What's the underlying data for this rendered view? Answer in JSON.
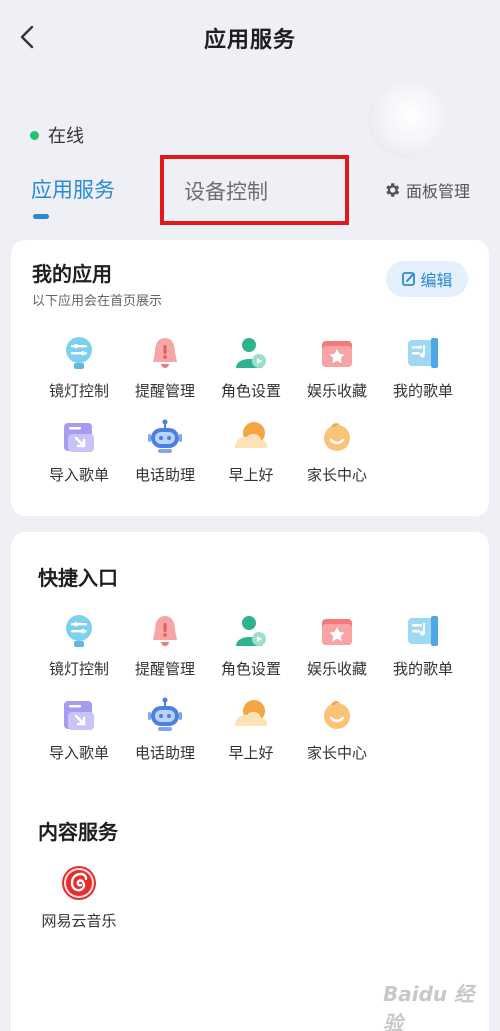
{
  "header": {
    "title": "应用服务"
  },
  "status": {
    "label": "在线"
  },
  "tabs": {
    "app_services": "应用服务",
    "device_control": "设备控制",
    "panel_management": "面板管理"
  },
  "my_apps": {
    "title": "我的应用",
    "subtitle": "以下应用会在首页展示",
    "edit_label": "编辑",
    "items": [
      {
        "label": "镜灯控制",
        "icon": "lamp-control-icon"
      },
      {
        "label": "提醒管理",
        "icon": "bell-icon"
      },
      {
        "label": "角色设置",
        "icon": "person-icon"
      },
      {
        "label": "娱乐收藏",
        "icon": "star-folder-icon"
      },
      {
        "label": "我的歌单",
        "icon": "playlist-icon"
      },
      {
        "label": "导入歌单",
        "icon": "import-playlist-icon"
      },
      {
        "label": "电话助理",
        "icon": "robot-icon"
      },
      {
        "label": "早上好",
        "icon": "sunrise-icon"
      },
      {
        "label": "家长中心",
        "icon": "family-icon"
      }
    ]
  },
  "quick_entry": {
    "title": "快捷入口",
    "items": [
      {
        "label": "镜灯控制",
        "icon": "lamp-control-icon"
      },
      {
        "label": "提醒管理",
        "icon": "bell-icon"
      },
      {
        "label": "角色设置",
        "icon": "person-icon"
      },
      {
        "label": "娱乐收藏",
        "icon": "star-folder-icon"
      },
      {
        "label": "我的歌单",
        "icon": "playlist-icon"
      },
      {
        "label": "导入歌单",
        "icon": "import-playlist-icon"
      },
      {
        "label": "电话助理",
        "icon": "robot-icon"
      },
      {
        "label": "早上好",
        "icon": "sunrise-icon"
      },
      {
        "label": "家长中心",
        "icon": "family-icon"
      }
    ]
  },
  "content_services": {
    "title": "内容服务",
    "items": [
      {
        "label": "网易云音乐",
        "icon": "netease-music-icon"
      }
    ]
  },
  "watermark": {
    "text": "Baidu 经验"
  },
  "colors": {
    "accent": "#2a8ad4",
    "online": "#22c46e",
    "highlight_box": "#e0191f",
    "background": "#eef0f6"
  }
}
